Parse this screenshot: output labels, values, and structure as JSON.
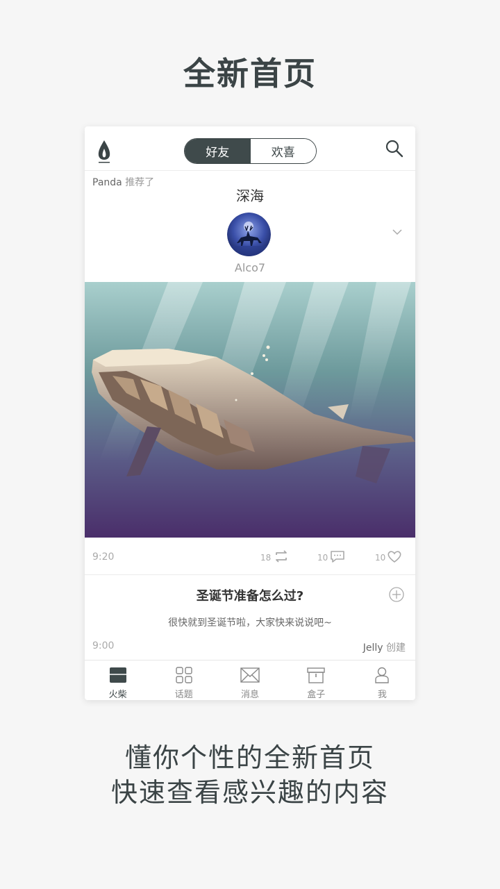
{
  "page": {
    "title": "全新首页",
    "subtitle_line1": "懂你个性的全新首页",
    "subtitle_line2": "快速查看感兴趣的内容"
  },
  "app": {
    "segment": {
      "friends": "好友",
      "likes": "欢喜",
      "selected": "好友"
    },
    "icons": {
      "logo": "flame-logo-icon",
      "search": "search-icon"
    }
  },
  "post": {
    "recommender": "Panda",
    "recommend_text": "推荐了",
    "title": "深海",
    "author": "Alco7",
    "time": "9:20",
    "repost_count": "18",
    "comment_count": "10",
    "like_count": "10"
  },
  "topic": {
    "title": "圣诞节准备怎么过?",
    "description": "很快就到圣诞节啦，大家快来说说吧~",
    "time": "9:00",
    "creator": "Jelly",
    "creator_suffix": "创建"
  },
  "tabs": [
    {
      "label": "火柴",
      "icon": "match-icon",
      "active": true
    },
    {
      "label": "话题",
      "icon": "grid-icon",
      "active": false
    },
    {
      "label": "消息",
      "icon": "envelope-icon",
      "active": false
    },
    {
      "label": "盒子",
      "icon": "box-icon",
      "active": false
    },
    {
      "label": "我",
      "icon": "person-icon",
      "active": false
    }
  ],
  "colors": {
    "accent": "#3f4a4b",
    "background": "#f6f6f6"
  }
}
